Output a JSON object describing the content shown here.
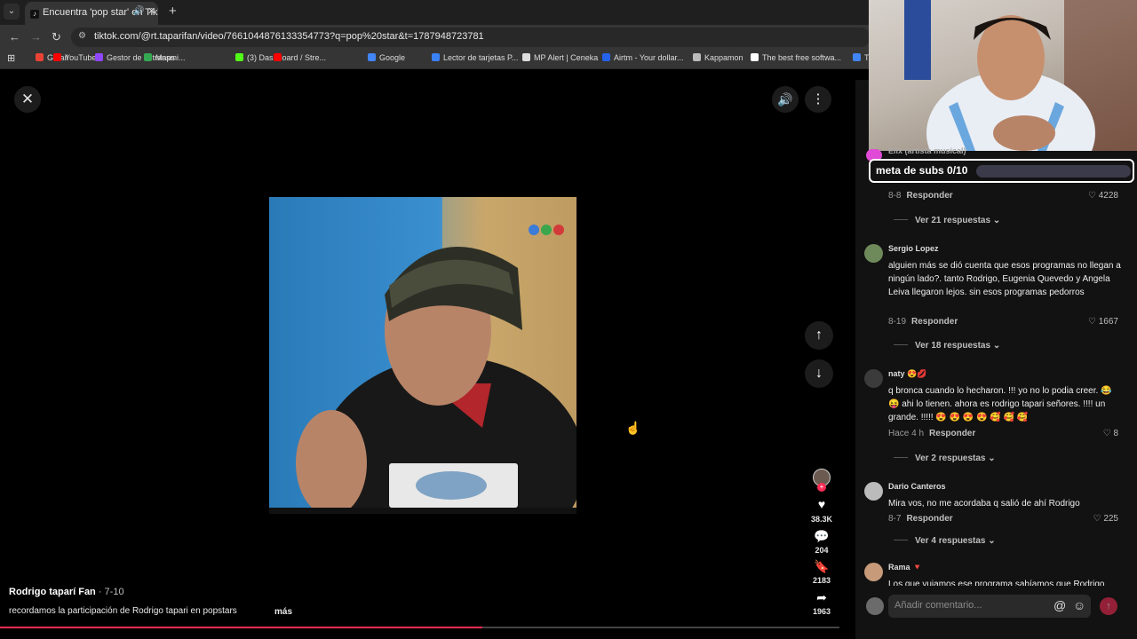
{
  "browser": {
    "tab_title": "Encuentra 'pop star' en TikT",
    "url": "tiktok.com/@rt.taparifan/video/7661044876133354773?q=pop%20star&t=1787948723781",
    "bookmarks": [
      {
        "label": "Gmail",
        "color": "#ea4335"
      },
      {
        "label": "YouTube",
        "color": "#ff0000"
      },
      {
        "label": "Gestor de la transmi...",
        "color": "#9146ff"
      },
      {
        "label": "Maps",
        "color": "#34a853"
      },
      {
        "label": "(3) Dashboard / Stre...",
        "color": "#53fc18"
      },
      {
        "label": "",
        "color": "#ff0000"
      },
      {
        "label": "Google",
        "color": "#4285f4"
      },
      {
        "label": "Lector de tarjetas P...",
        "color": "#3b82f6"
      },
      {
        "label": "MP Alert | Ceneka",
        "color": "#dddddd"
      },
      {
        "label": "Airtm - Your dollar...",
        "color": "#2563eb"
      },
      {
        "label": "Kappamon",
        "color": "#bbbbbb"
      },
      {
        "label": "The best free softwa...",
        "color": "#ffffff"
      },
      {
        "label": "Tradu",
        "color": "#4285f4"
      }
    ]
  },
  "video": {
    "author": "Rodrigo taparí Fan",
    "date": " · 7-10",
    "description": "recordamos la participación de Rodrigo tapari en popstars",
    "more": "más",
    "progress": 0.575,
    "accent": "#fe2c55"
  },
  "actions": {
    "likes": "38.3K",
    "comments": "204",
    "saves": "2183",
    "shares": "1963"
  },
  "overlay": {
    "subs_goal": "meta de subs 0/10",
    "partial_name": "Elix (artista musical)"
  },
  "comments": [
    {
      "name": "",
      "text": "",
      "time": "8-8",
      "reply": "Responder",
      "likes": "4228",
      "replies": "Ver 21 respuestas"
    },
    {
      "name": "Sergio Lopez",
      "text": "alguien más se dió cuenta que esos programas no llegan a ningún lado?. tanto Rodrigo, Eugenia Quevedo y Angela Leiva llegaron lejos. sin esos programas pedorros",
      "time": "8-19",
      "reply": "Responder",
      "likes": "1667",
      "replies": "Ver 18 respuestas"
    },
    {
      "name": "naty 😍💋",
      "text": "q bronca cuando lo hecharon. !!! yo no lo podia creer. 😂 😝 ahi lo tienen. ahora es rodrigo tapari señores. !!!! un grande. !!!!! 😍 😍 😍 😍 🥰 🥰 🥰",
      "time": "Hace 4 h",
      "reply": "Responder",
      "likes": "8",
      "replies": "Ver 2 respuestas"
    },
    {
      "name": "Dario Canteros",
      "text": "Mira vos, no me acordaba q salió de ahí Rodrigo",
      "time": "8-7",
      "reply": "Responder",
      "likes": "225",
      "replies": "Ver 4 respuestas"
    },
    {
      "name": "Rama 🔻",
      "text": "Los que vuiamos ese programa sabíamos que Rodrigo",
      "time": "",
      "reply": "",
      "likes": "",
      "replies": ""
    }
  ],
  "input": {
    "placeholder": "Añadir comentario..."
  }
}
